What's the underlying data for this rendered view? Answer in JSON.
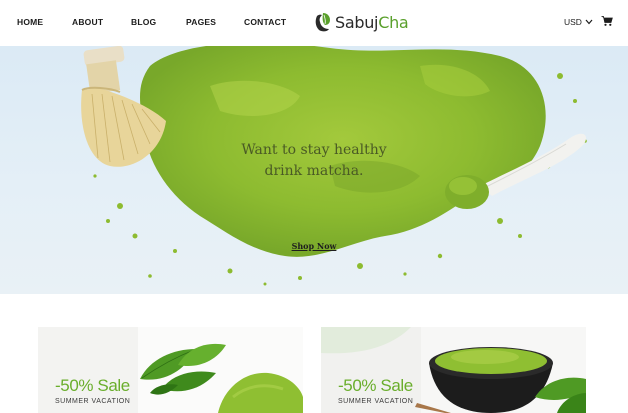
{
  "nav": {
    "items": [
      {
        "label": "HOME"
      },
      {
        "label": "ABOUT"
      },
      {
        "label": "BLOG"
      },
      {
        "label": "PAGES"
      },
      {
        "label": "CONTACT"
      }
    ]
  },
  "logo": {
    "part1": "Sabuj",
    "part2": "Cha",
    "icon": "tea-leaf-icon"
  },
  "currency": {
    "label": "USD"
  },
  "cart": {
    "icon": "cart-icon"
  },
  "hero": {
    "title_line1": "Want to stay healthy",
    "title_line2": "drink matcha.",
    "cta": "Shop Now"
  },
  "promos": [
    {
      "headline": "-50% Sale",
      "subtitle": "SUMMER VACATION"
    },
    {
      "headline": "-50% Sale",
      "subtitle": "SUMMER VACATION"
    }
  ],
  "colors": {
    "accent": "#5aa02c",
    "matcha": "#8cbe32",
    "sky": "#dbeaf5"
  }
}
